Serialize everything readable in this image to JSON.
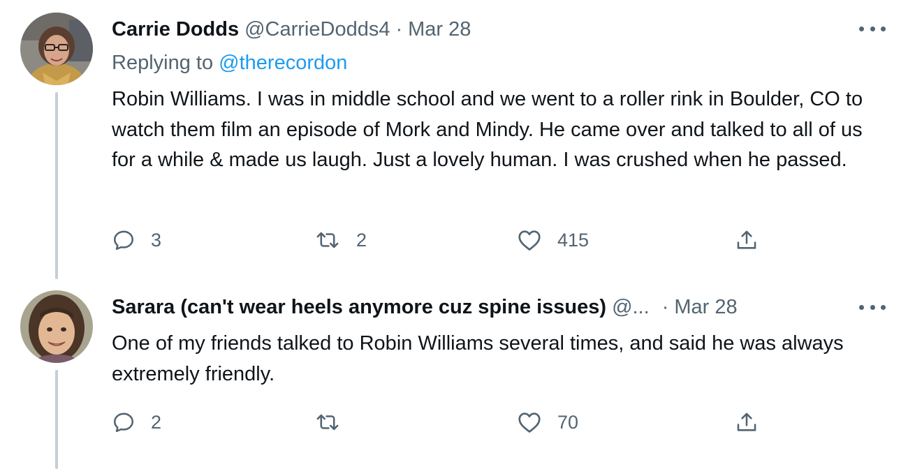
{
  "tweets": [
    {
      "display_name": "Carrie Dodds",
      "handle": "@CarrieDodds4",
      "separator": "·",
      "date": "Mar 28",
      "replying_prefix": "Replying to ",
      "replying_to": "@therecordon",
      "text": "Robin Williams. I was in middle school and we went to a roller rink in Boulder, CO to watch them film an episode of Mork and Mindy. He came over and talked to all of us for a while & made us laugh. Just a lovely human. I was crushed when he passed.",
      "reply_count": "3",
      "retweet_count": "2",
      "like_count": "415"
    },
    {
      "display_name": "Sarara (can't wear heels anymore cuz spine issues)",
      "handle": "@...",
      "separator": "·",
      "date": "Mar 28",
      "text": "One of my friends talked to Robin Williams several times, and said he was always extremely friendly.",
      "reply_count": "2",
      "retweet_count": "",
      "like_count": "70"
    }
  ],
  "icons": {
    "reply": "reply-icon",
    "retweet": "retweet-icon",
    "like": "heart-icon",
    "share": "share-icon",
    "more": "more-icon"
  },
  "colors": {
    "text": "#0f1419",
    "secondary": "#536471",
    "link": "#1d9bf0",
    "thread_line": "#c4cfd6"
  }
}
